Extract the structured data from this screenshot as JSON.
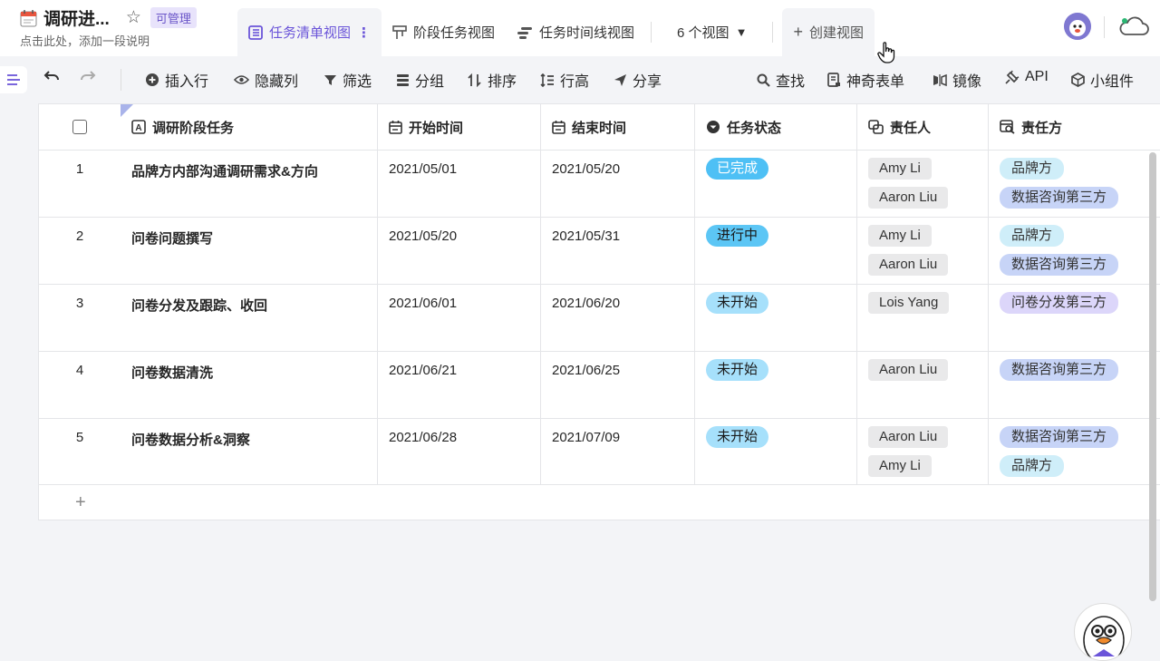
{
  "header": {
    "title": "调研进...",
    "badge": "可管理",
    "subtitle": "点击此处，添加一段说明"
  },
  "tabs": [
    {
      "label": "任务清单视图",
      "active": true
    },
    {
      "label": "阶段任务视图"
    },
    {
      "label": "任务时间线视图"
    },
    {
      "label": "6 个视图"
    },
    {
      "label": "创建视图"
    }
  ],
  "toolbar": {
    "insert_row": "插入行",
    "hide_cols": "隐藏列",
    "filter": "筛选",
    "group": "分组",
    "sort": "排序",
    "row_height": "行高",
    "share": "分享",
    "find": "查找",
    "magic_form": "神奇表单",
    "mirror": "镜像",
    "api": "API",
    "widget": "小组件"
  },
  "columns": [
    "调研阶段任务",
    "开始时间",
    "结束时间",
    "任务状态",
    "责任人",
    "责任方"
  ],
  "rows": [
    {
      "num": "1",
      "task": "品牌方内部沟通调研需求&方向",
      "start": "2021/05/01",
      "end": "2021/05/20",
      "status": "已完成",
      "persons": [
        "Amy Li",
        "Aaron Liu"
      ],
      "parties": [
        "品牌方",
        "数据咨询第三方"
      ]
    },
    {
      "num": "2",
      "task": "问卷问题撰写",
      "start": "2021/05/20",
      "end": "2021/05/31",
      "status": "进行中",
      "persons": [
        "Amy Li",
        "Aaron Liu"
      ],
      "parties": [
        "品牌方",
        "数据咨询第三方"
      ]
    },
    {
      "num": "3",
      "task": "问卷分发及跟踪、收回",
      "start": "2021/06/01",
      "end": "2021/06/20",
      "status": "未开始",
      "persons": [
        "Lois Yang"
      ],
      "parties": [
        "问卷分发第三方"
      ]
    },
    {
      "num": "4",
      "task": "问卷数据清洗",
      "start": "2021/06/21",
      "end": "2021/06/25",
      "status": "未开始",
      "persons": [
        "Aaron Liu"
      ],
      "parties": [
        "数据咨询第三方"
      ]
    },
    {
      "num": "5",
      "task": "问卷数据分析&洞察",
      "start": "2021/06/28",
      "end": "2021/07/09",
      "status": "未开始",
      "persons": [
        "Aaron Liu",
        "Amy Li"
      ],
      "parties": [
        "数据咨询第三方",
        "品牌方"
      ]
    }
  ],
  "add_row": "+",
  "colors": {
    "accent": "#6b55d9",
    "status_done": "#4ec0f5",
    "status_doing": "#5cc6f5",
    "status_todo": "#a6e0fb"
  }
}
